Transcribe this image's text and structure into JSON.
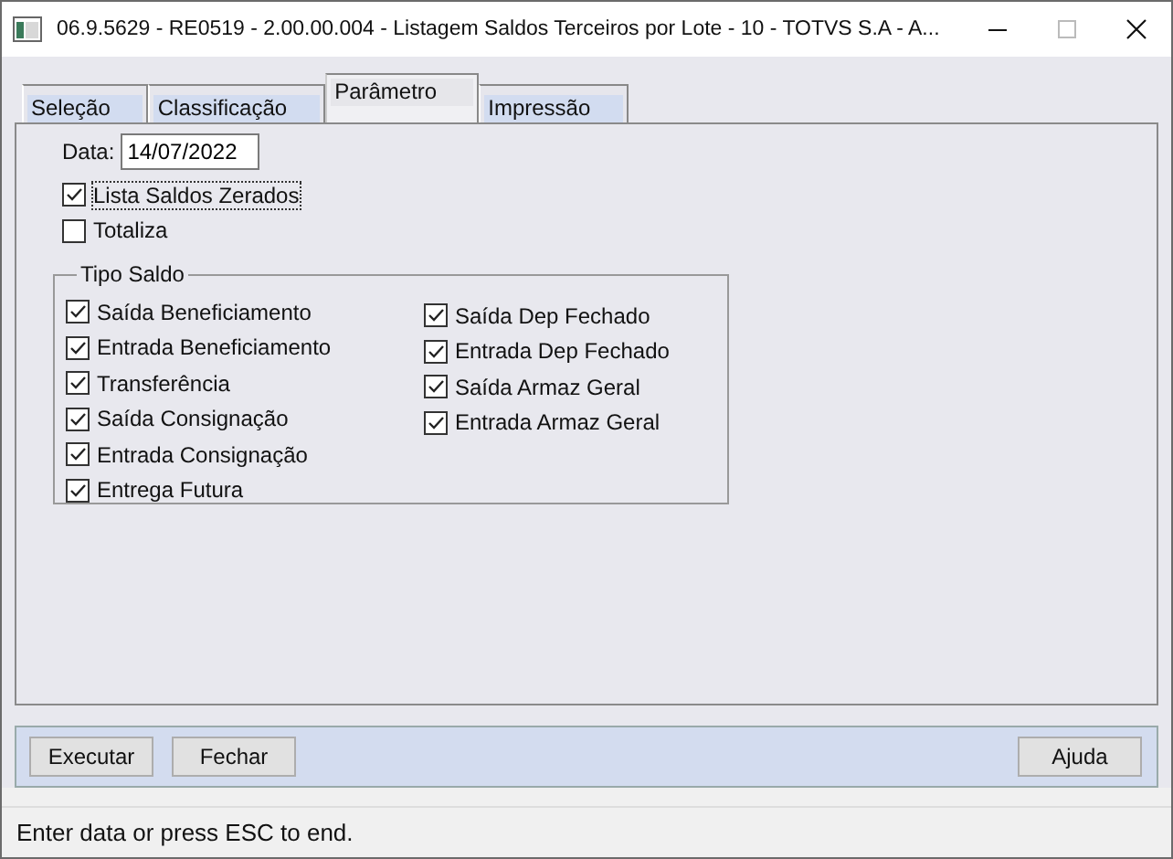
{
  "window": {
    "title": "06.9.5629 - RE0519 - 2.00.00.004 - Listagem Saldos Terceiros por Lote - 10 - TOTVS S.A - A..."
  },
  "tabs": [
    {
      "label": "Seleção",
      "selected": false
    },
    {
      "label": "Classificação",
      "selected": false
    },
    {
      "label": "Parâmetro",
      "selected": true
    },
    {
      "label": "Impressão",
      "selected": false
    }
  ],
  "date": {
    "label": "Data:",
    "value": "14/07/2022"
  },
  "options": [
    {
      "label": "Lista Saldos Zerados",
      "checked": true,
      "focused": true
    },
    {
      "label": "Totaliza",
      "checked": false,
      "focused": false
    }
  ],
  "tipo_saldo": {
    "title": "Tipo Saldo",
    "columns": [
      [
        {
          "label": "Saída Beneficiamento",
          "checked": true
        },
        {
          "label": "Entrada Beneficiamento",
          "checked": true
        },
        {
          "label": "Transferência",
          "checked": true
        },
        {
          "label": "Saída Consignação",
          "checked": true
        },
        {
          "label": "Entrada Consignação",
          "checked": true
        },
        {
          "label": "Entrega Futura",
          "checked": true
        }
      ],
      [
        {
          "label": "Saída Dep Fechado",
          "checked": true
        },
        {
          "label": "Entrada Dep Fechado",
          "checked": true
        },
        {
          "label": "Saída Armaz Geral",
          "checked": true
        },
        {
          "label": "Entrada Armaz Geral",
          "checked": true
        }
      ]
    ]
  },
  "button_bar": {
    "left": [
      "Executar",
      "Fechar"
    ],
    "right": [
      "Ajuda"
    ]
  },
  "status_bar": "Enter data or press ESC to end."
}
